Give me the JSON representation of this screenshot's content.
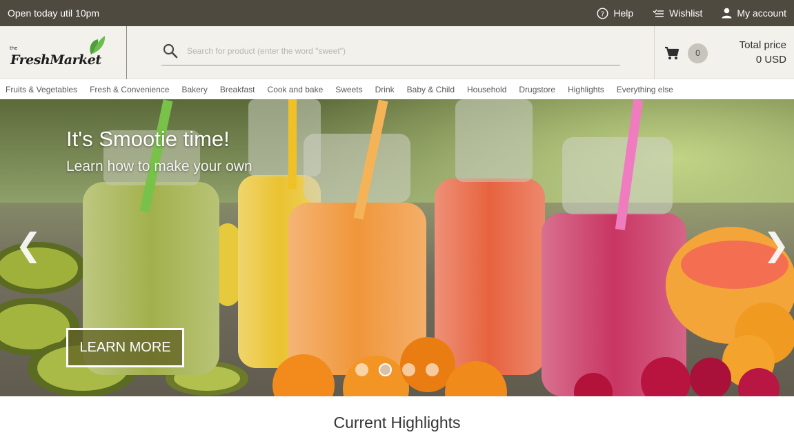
{
  "topbar": {
    "open_text": "Open today util 10pm",
    "links": [
      {
        "icon": "help-icon",
        "label": "Help"
      },
      {
        "icon": "wishlist-icon",
        "label": "Wishlist"
      },
      {
        "icon": "account-icon",
        "label": "My account"
      }
    ]
  },
  "header": {
    "logo_small": "the",
    "logo_name": "FreshMarket",
    "search_placeholder": "Search for product (enter the word \"sweet\")",
    "cart_count": "0",
    "total_label": "Total price",
    "total_value": "0 USD"
  },
  "categories": [
    "Fruits & Vegetables",
    "Fresh & Convenience",
    "Bakery",
    "Breakfast",
    "Cook and bake",
    "Sweets",
    "Drink",
    "Baby & Child",
    "Household",
    "Drugstore",
    "Highlights",
    "Everything else"
  ],
  "hero": {
    "title": "It's Smootie time!",
    "subtitle": "Learn how to make your own",
    "button": "LEARN MORE",
    "prev_arrow": "❮",
    "next_arrow": "❯",
    "slide_count": 4,
    "active_slide": 2
  },
  "section_title": "Current Highlights",
  "colors": {
    "topbar": "#4f4a40",
    "header": "#f2f1ec",
    "logo_leaf": "#5fae45"
  }
}
